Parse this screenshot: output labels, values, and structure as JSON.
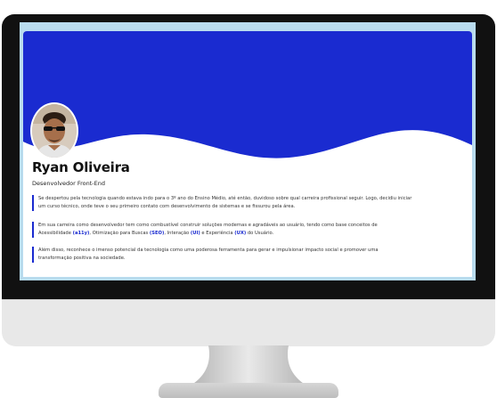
{
  "colors": {
    "accent": "#1a2bd0",
    "screen_frame": "#b9dcef",
    "bezel": "#111111"
  },
  "profile": {
    "name": "Ryan Oliveira",
    "role": "Desenvolvedor Front-End",
    "avatar_icon": "profile-photo"
  },
  "about": {
    "p1_l1": "Se despertou pela tecnologia quando estava indo para o 3º ano do Ensino Médio, até então, duvidoso sobre qual carreira profissional seguir. Logo, decidiu iniciar",
    "p1_l2": "um curso técnico, onde teve o seu primeiro contato com desenvolvimento de sistemas e se fissurou pela área.",
    "p2_l1": "Em sua carreira como desenvolvedor tem como combustível construir soluções modernas e agradáveis ao usuário, tendo como base conceitos de",
    "p2_l2": {
      "t1": "Acessibilidade ",
      "k1": "(a11y)",
      "t2": ", Otimização para Buscas ",
      "k2": "(SEO)",
      "t3": ", Interação ",
      "k3": "(UI)",
      "t4": " e Experiência ",
      "k4": "(UX)",
      "t5": " do Usuário."
    },
    "p3_l1": "Além disso, reconhece o imenso potencial da tecnologia como uma poderosa ferramenta para gerar e impulsionar impacto social e promover uma",
    "p3_l2": "transformação positiva na sociedade."
  }
}
